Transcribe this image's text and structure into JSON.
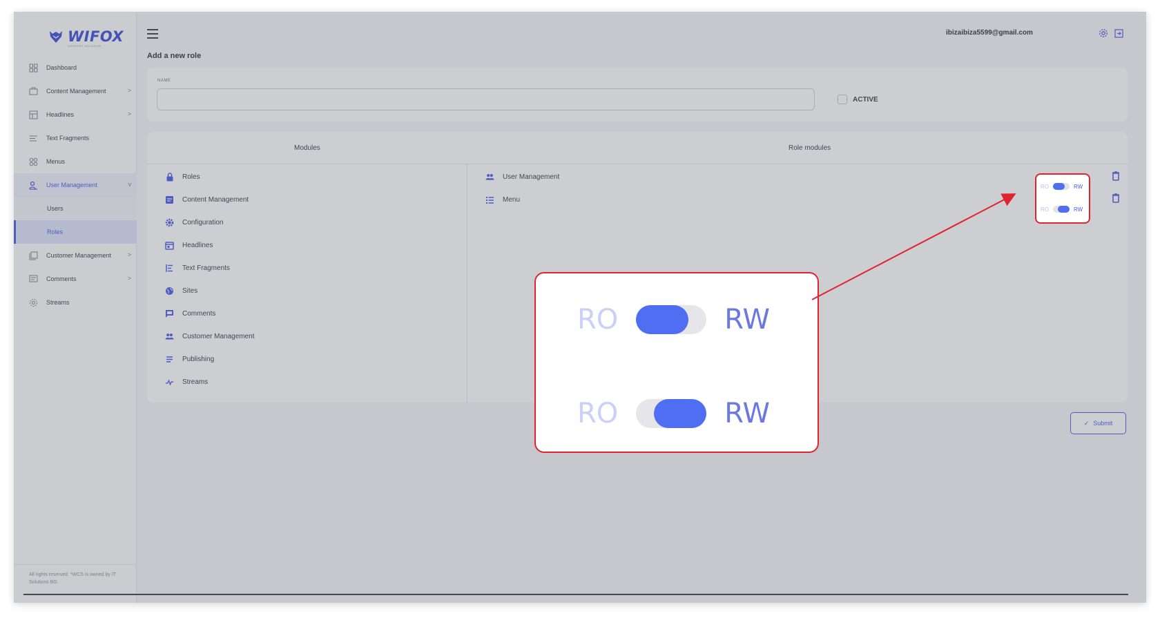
{
  "app": {
    "brand": "WIFOX",
    "brand_sub": "CONTENT SOLUTION",
    "copyright": "All rights reserved. *WCS is owned by IT Solutions BG."
  },
  "sidebar": {
    "items": [
      {
        "label": "Dashboard",
        "icon": "dashboard-icon"
      },
      {
        "label": "Content Management",
        "icon": "content-icon",
        "chevron": ">"
      },
      {
        "label": "Headlines",
        "icon": "headlines-icon",
        "chevron": ">"
      },
      {
        "label": "Text Fragments",
        "icon": "text-fragments-icon"
      },
      {
        "label": "Menus",
        "icon": "menus-icon"
      },
      {
        "label": "User Management",
        "icon": "users-icon",
        "chevron": "v"
      },
      {
        "label": "Customer Management",
        "icon": "customer-icon",
        "chevron": ">"
      },
      {
        "label": "Comments",
        "icon": "comments-icon",
        "chevron": ">"
      },
      {
        "label": "Streams",
        "icon": "streams-icon"
      }
    ],
    "sub_items": [
      {
        "label": "Users"
      },
      {
        "label": "Roles"
      }
    ]
  },
  "header": {
    "email": "ibizaibiza5599@gmail.com"
  },
  "page": {
    "title": "Add a new role",
    "name_label": "NAME",
    "name_value": "",
    "active_label": "ACTIVE",
    "modules_header": "Modules",
    "role_modules_header": "Role modules",
    "submit_label": "Submit"
  },
  "modules": [
    {
      "label": "Roles",
      "icon": "lock-icon"
    },
    {
      "label": "Content Management",
      "icon": "content-icon"
    },
    {
      "label": "Configuration",
      "icon": "gear-icon"
    },
    {
      "label": "Headlines",
      "icon": "headlines-icon"
    },
    {
      "label": "Text Fragments",
      "icon": "text-fragments-icon"
    },
    {
      "label": "Sites",
      "icon": "globe-icon"
    },
    {
      "label": "Comments",
      "icon": "comment-icon"
    },
    {
      "label": "Customer Management",
      "icon": "customer-icon"
    },
    {
      "label": "Publishing",
      "icon": "publishing-icon"
    },
    {
      "label": "Streams",
      "icon": "streams-icon"
    }
  ],
  "role_modules": [
    {
      "label": "User Management",
      "icon": "users-icon",
      "ro": "RO",
      "rw": "RW",
      "mode": "RO"
    },
    {
      "label": "Menu",
      "icon": "menu-list-icon",
      "ro": "RO",
      "rw": "RW",
      "mode": "RW"
    }
  ],
  "zoom": {
    "rows": [
      {
        "ro": "RO",
        "rw": "RW",
        "mode": "RO"
      },
      {
        "ro": "RO",
        "rw": "RW",
        "mode": "RW"
      }
    ]
  },
  "colors": {
    "accent": "#4a5ee6",
    "highlight": "#e0232e"
  }
}
